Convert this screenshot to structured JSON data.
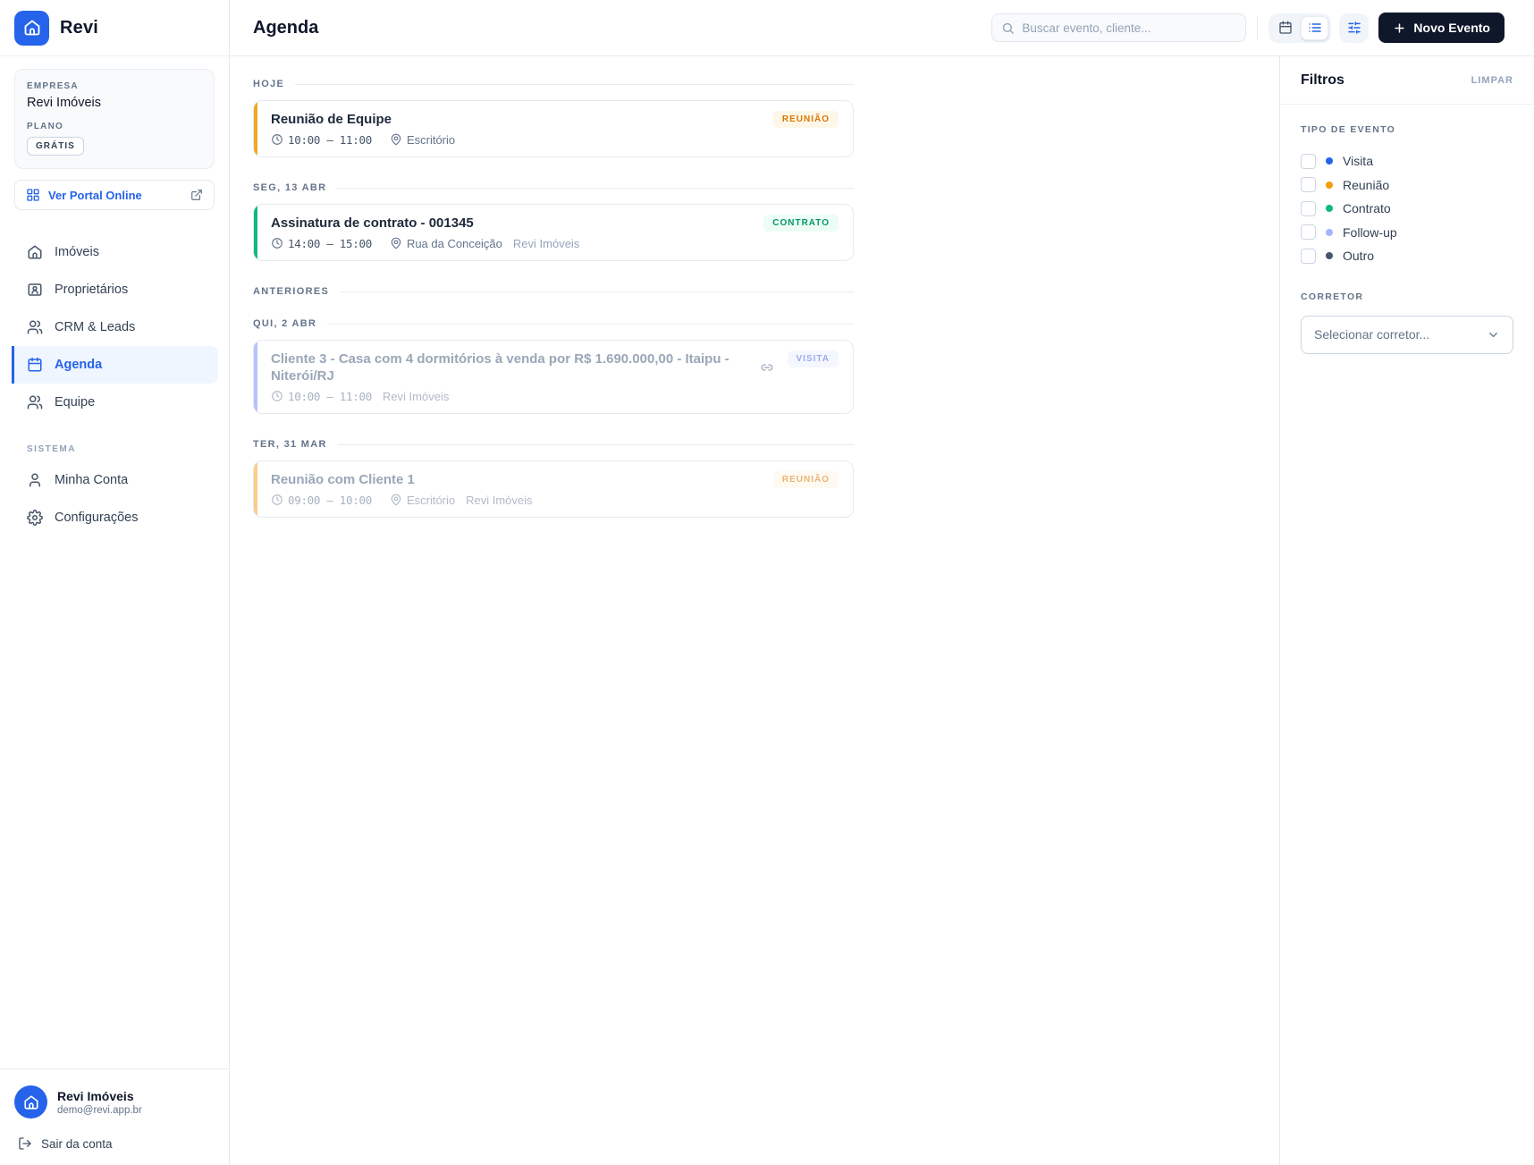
{
  "app": {
    "brand": "Revi"
  },
  "colors": {
    "primary": "#2563eb",
    "new_event_button_bg": "#0f172a"
  },
  "sidebar": {
    "company_label": "EMPRESA",
    "company_name": "Revi Imóveis",
    "plan_label": "PLANO",
    "plan_badge": "GRÁTIS",
    "portal_button_label": "Ver Portal Online",
    "nav": [
      {
        "label": "Imóveis"
      },
      {
        "label": "Proprietários"
      },
      {
        "label": "CRM & Leads"
      },
      {
        "label": "Agenda"
      },
      {
        "label": "Equipe"
      }
    ],
    "system_label": "SISTEMA",
    "system_nav": [
      {
        "label": "Minha Conta"
      },
      {
        "label": "Configurações"
      }
    ],
    "footer": {
      "name": "Revi Imóveis",
      "email": "demo@revi.app.br",
      "logout_label": "Sair da conta"
    }
  },
  "header": {
    "title": "Agenda",
    "search_placeholder": "Buscar evento, cliente...",
    "new_event_label": "Novo Evento"
  },
  "agenda": {
    "type_colors": {
      "reuniao": {
        "accent": "#f5a623",
        "badge_bg": "#fef7e8",
        "badge_text": "#d97706"
      },
      "contrato": {
        "accent": "#10b981",
        "badge_bg": "#ecfdf5",
        "badge_text": "#059669"
      },
      "visita": {
        "accent": "#818cf8",
        "badge_bg": "#eef2ff",
        "badge_text": "#4e63e0"
      }
    },
    "sections": [
      {
        "label": "HOJE"
      },
      {
        "label": "SEG, 13 ABR"
      },
      {
        "label": "ANTERIORES"
      },
      {
        "label": "QUI, 2 ABR"
      },
      {
        "label": "TER, 31 MAR"
      }
    ],
    "events": [
      {
        "title": "Reunião de Equipe",
        "time": "10:00 – 11:00",
        "location": "Escritório",
        "badge": "REUNIÃO",
        "type": "reuniao",
        "past": false
      },
      {
        "title": "Assinatura de contrato - 001345",
        "time": "14:00 – 15:00",
        "location": "Rua da Conceição",
        "company": "Revi Imóveis",
        "badge": "CONTRATO",
        "type": "contrato",
        "past": false
      },
      {
        "title": "Cliente 3 - Casa com 4 dormitórios à venda por R$ 1.690.000,00 - Itaipu - Niterói/RJ",
        "time": "10:00 – 11:00",
        "company": "Revi Imóveis",
        "badge": "VISITA",
        "type": "visita",
        "past": true
      },
      {
        "title": "Reunião com Cliente 1",
        "time": "09:00 – 10:00",
        "location": "Escritório",
        "company": "Revi Imóveis",
        "badge": "REUNIÃO",
        "type": "reuniao",
        "past": true
      }
    ]
  },
  "filters": {
    "title": "Filtros",
    "clear_label": "LIMPAR",
    "type_section_label": "TIPO DE EVENTO",
    "types": [
      {
        "label": "Visita",
        "color": "#2563eb",
        "checked": false
      },
      {
        "label": "Reunião",
        "color": "#f59e0b",
        "checked": false
      },
      {
        "label": "Contrato",
        "color": "#10b981",
        "checked": false
      },
      {
        "label": "Follow-up",
        "color": "#a5b4fc",
        "checked": false
      },
      {
        "label": "Outro",
        "color": "#475569",
        "checked": false
      }
    ],
    "corretor_section_label": "CORRETOR",
    "corretor_placeholder": "Selecionar corretor..."
  }
}
